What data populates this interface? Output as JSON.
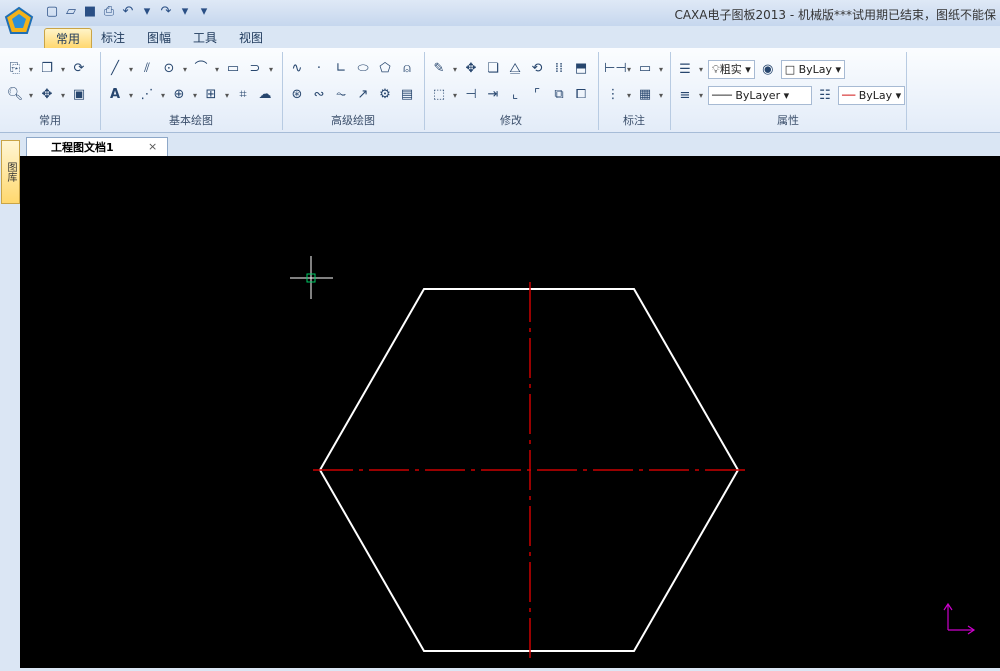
{
  "window": {
    "title": "CAXA电子图板2013 - 机械版***试用期已结束，图纸不能保"
  },
  "quick_access": [
    "new-icon",
    "open-icon",
    "save-icon",
    "print-icon",
    "undo-icon",
    "redo-icon"
  ],
  "tabs": [
    {
      "label": "常用",
      "active": true
    },
    {
      "label": "标注",
      "active": false
    },
    {
      "label": "图幅",
      "active": false
    },
    {
      "label": "工具",
      "active": false
    },
    {
      "label": "视图",
      "active": false
    }
  ],
  "ribbon": {
    "groups": {
      "common": "常用",
      "basic_draw": "基本绘图",
      "advanced_draw": "高级绘图",
      "modify": "修改",
      "annotate": "标注",
      "properties": "属性"
    },
    "properties": {
      "layer_name": "粗实",
      "color_value": "ByLay",
      "linetype_value": "ByLayer",
      "lineweight_value": "ByLay"
    }
  },
  "document": {
    "tab_label": "工程图文档1",
    "close_glyph": "×"
  },
  "left_dock": {
    "label": "图库"
  },
  "colors": {
    "canvas_bg": "#000000",
    "outline": "#ffffff",
    "centerline": "#cc0000",
    "cursor": "#ffffff",
    "cursor_box": "#00cc66",
    "ucs": "#cc00cc"
  }
}
